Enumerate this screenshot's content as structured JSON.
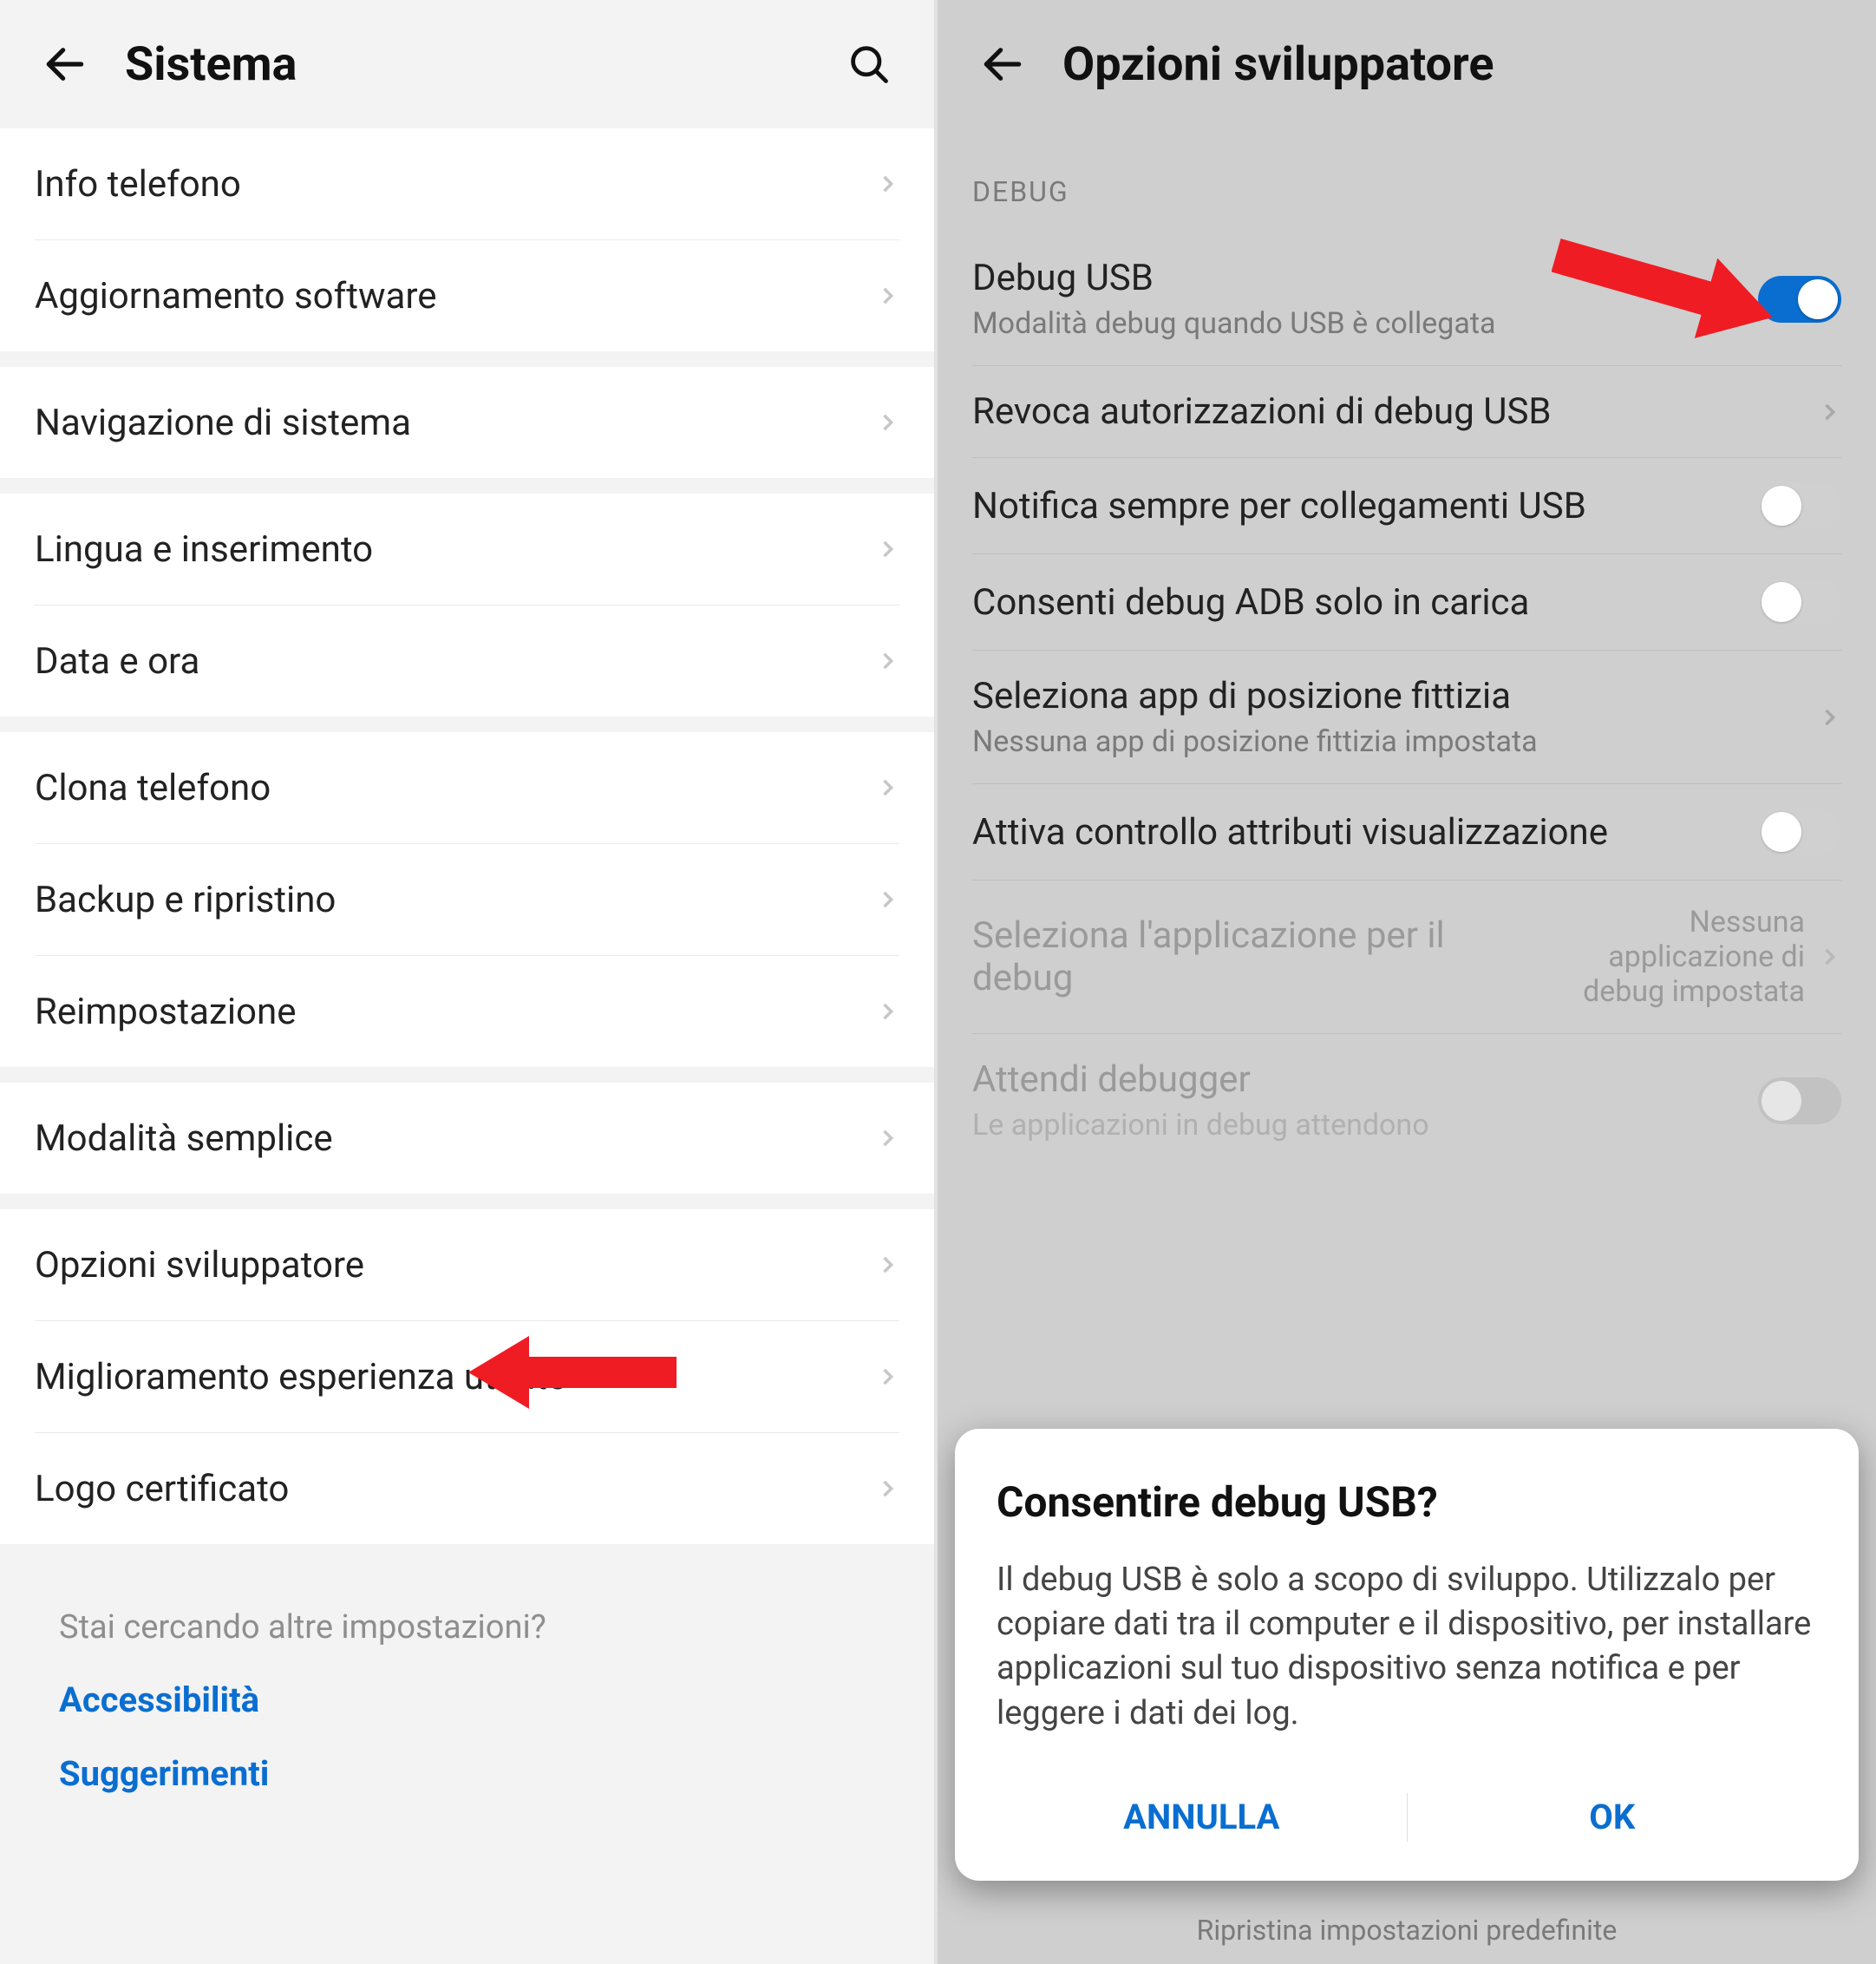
{
  "left": {
    "title": "Sistema",
    "rows": {
      "info": "Info telefono",
      "update": "Aggiornamento software",
      "nav": "Navigazione di sistema",
      "lang": "Lingua e inserimento",
      "date": "Data e ora",
      "clone": "Clona telefono",
      "backup": "Backup e ripristino",
      "reset": "Reimpostazione",
      "simple": "Modalità semplice",
      "dev": "Opzioni sviluppatore",
      "ux": "Miglioramento esperienza utente",
      "logo": "Logo certificato"
    },
    "hint": {
      "q": "Stai cercando altre impostazioni?",
      "a11y": "Accessibilità",
      "sugg": "Suggerimenti"
    }
  },
  "right": {
    "title": "Opzioni sviluppatore",
    "section": "DEBUG",
    "rows": {
      "usb_debug": {
        "title": "Debug USB",
        "sub": "Modalità debug quando USB è collegata"
      },
      "revoke": {
        "title": "Revoca autorizzazioni di debug USB"
      },
      "notify": {
        "title": "Notifica sempre per collegamenti USB"
      },
      "adb": {
        "title": "Consenti debug ADB solo in carica"
      },
      "mockloc": {
        "title": "Seleziona app di posizione fittizia",
        "sub": "Nessuna app di posizione fittizia impostata"
      },
      "viewattr": {
        "title": "Attiva controllo attributi visualizzazione"
      },
      "dbgapp": {
        "title": "Seleziona l'applicazione per il debug",
        "rval": "Nessuna applicazione di debug impostata"
      },
      "waitdbg": {
        "title": "Attendi debugger",
        "sub": "Le applicazioni in debug attendono"
      }
    },
    "dialog": {
      "title": "Consentire debug USB?",
      "body": "Il debug USB è solo a scopo di sviluppo. Utilizzalo per copiare dati tra il computer e il dispositivo, per installare applicazioni sul tuo dispositivo senza notifica e per leggere i dati dei log.",
      "cancel": "ANNULLA",
      "ok": "OK"
    },
    "footnote": "Ripristina impostazioni predefinite"
  }
}
